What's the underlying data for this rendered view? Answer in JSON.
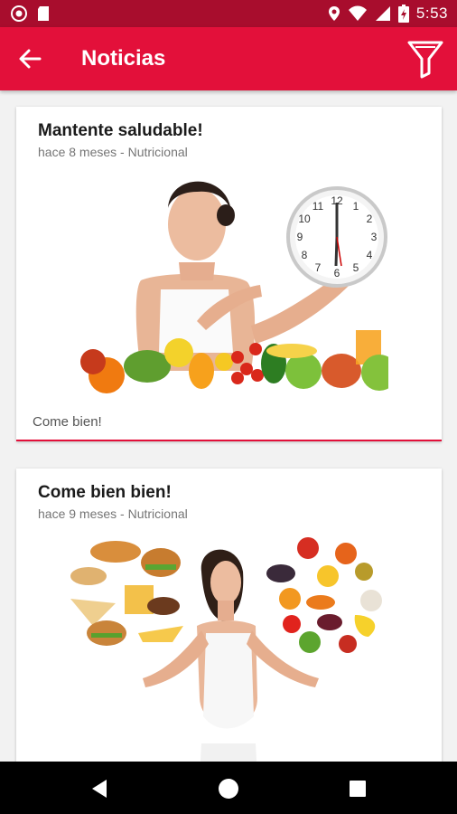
{
  "status_bar": {
    "time": "5:53",
    "icons": [
      "notification-icon",
      "sd-card-icon",
      "location-icon",
      "wifi-icon",
      "signal-icon",
      "battery-icon"
    ]
  },
  "app_bar": {
    "title": "Noticias",
    "back_icon": "arrow-left-icon",
    "filter_icon": "filter-icon",
    "color": "#e3103a"
  },
  "news": [
    {
      "title": "Mantente saludable!",
      "time_ago": "hace 8 meses -",
      "category": "Nutricional",
      "body": "Come bien!"
    },
    {
      "title": "Come bien bien!",
      "time_ago": "hace 9 meses -",
      "category": "Nutricional"
    }
  ],
  "nav_bar": {
    "icons": [
      "back-triangle-icon",
      "home-circle-icon",
      "recents-square-icon"
    ]
  }
}
